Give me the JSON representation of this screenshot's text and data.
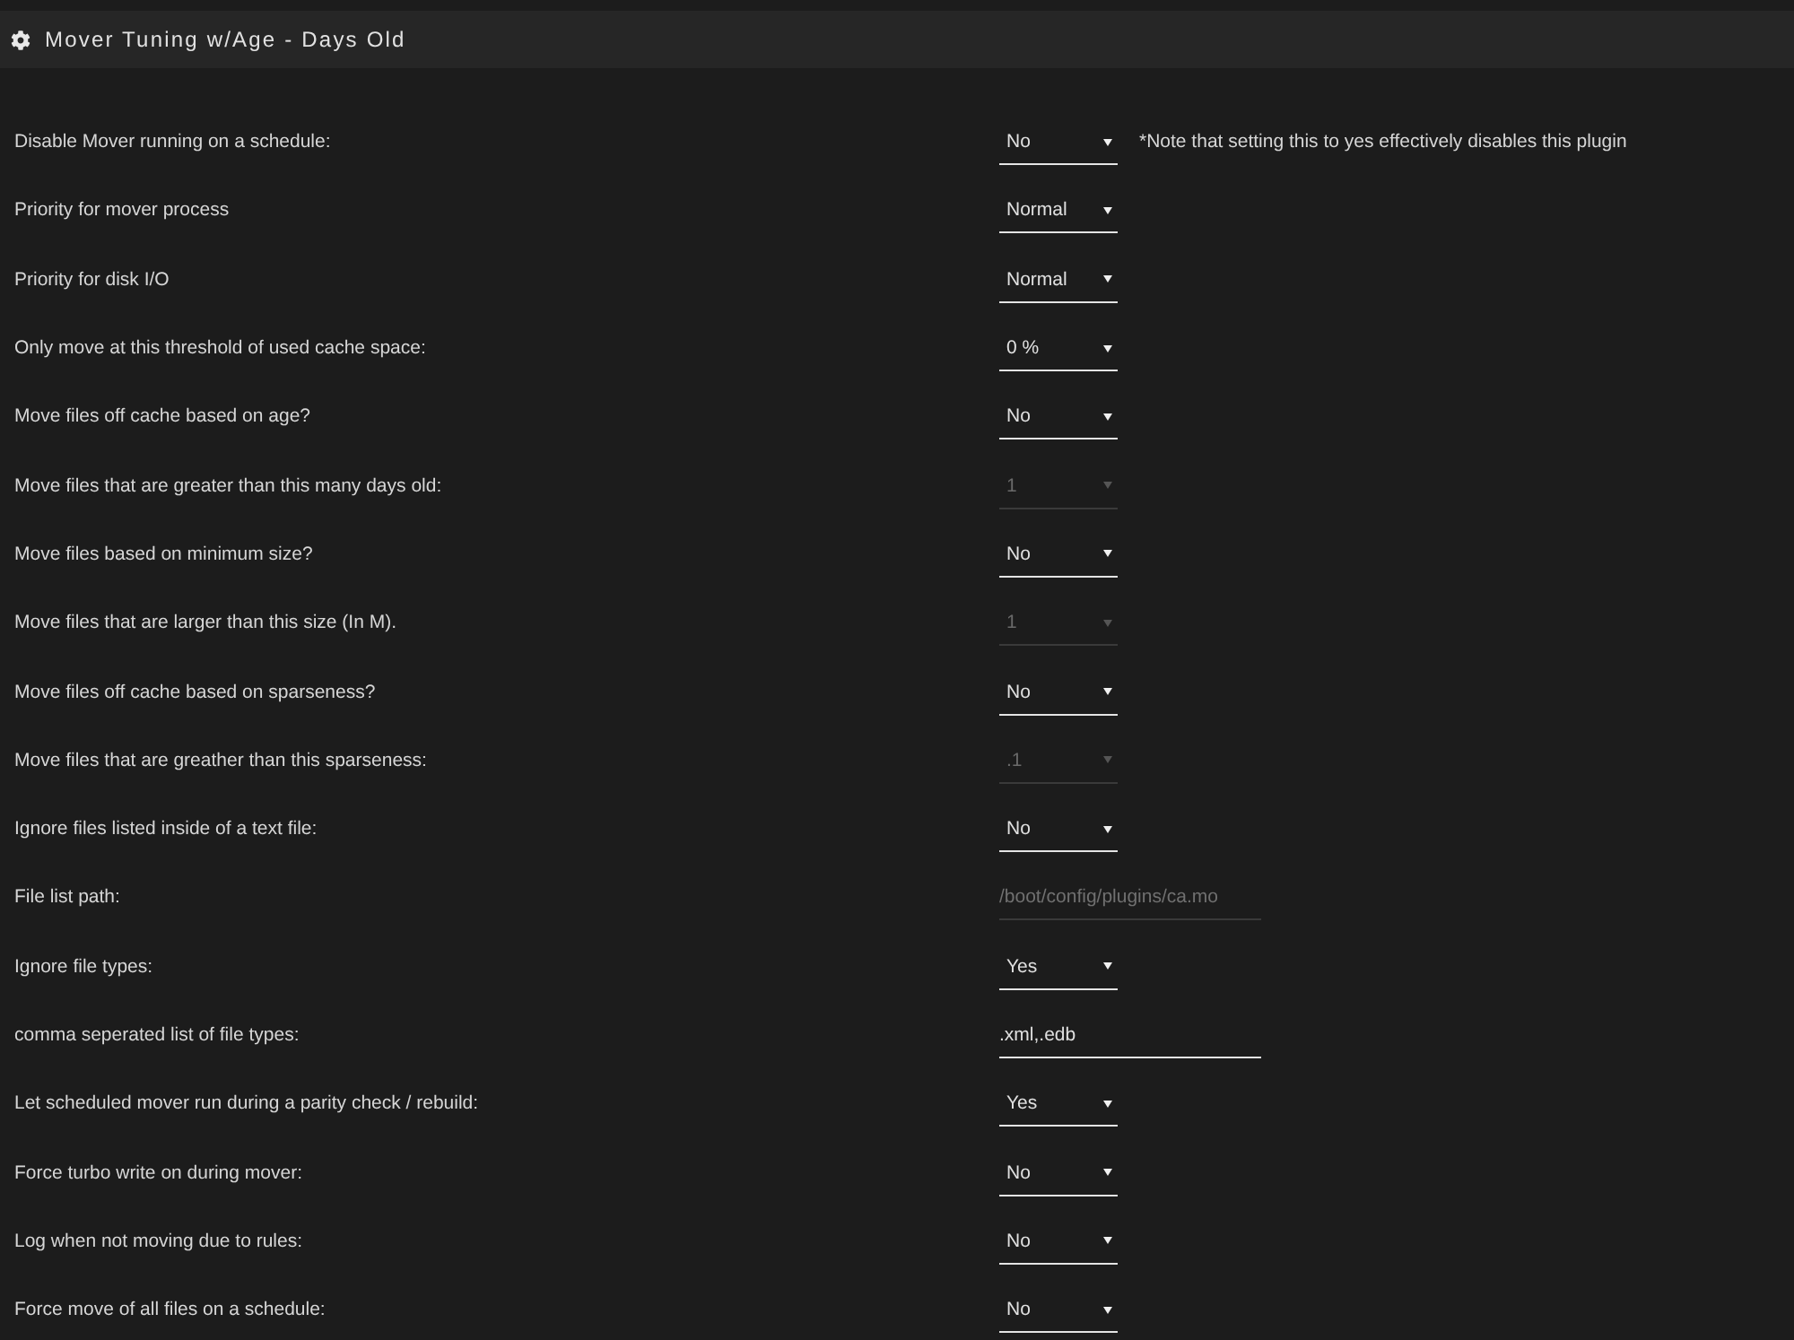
{
  "panel": {
    "title": "Mover Tuning w/Age - Days Old"
  },
  "settings": [
    {
      "label": "Disable Mover running on a schedule:",
      "kind": "select",
      "value": "No",
      "disabled": false,
      "note": "*Note that setting this to yes effectively disables this plugin"
    },
    {
      "label": "Priority for mover process",
      "kind": "select",
      "value": "Normal",
      "disabled": false
    },
    {
      "label": "Priority for disk I/O",
      "kind": "select",
      "value": "Normal",
      "disabled": false
    },
    {
      "label": "Only move at this threshold of used cache space:",
      "kind": "select",
      "value": "0 %",
      "disabled": false
    },
    {
      "label": "Move files off cache based on age?",
      "kind": "select",
      "value": "No",
      "disabled": false
    },
    {
      "label": "Move files that are greater than this many days old:",
      "kind": "select",
      "value": "1",
      "disabled": true
    },
    {
      "label": "Move files based on minimum size?",
      "kind": "select",
      "value": "No",
      "disabled": false
    },
    {
      "label": "Move files that are larger than this size (In M).",
      "kind": "select",
      "value": "1",
      "disabled": true
    },
    {
      "label": "Move files off cache based on sparseness?",
      "kind": "select",
      "value": "No",
      "disabled": false
    },
    {
      "label": "Move files that are greather than this sparseness:",
      "kind": "select",
      "value": ".1",
      "disabled": true
    },
    {
      "label": "Ignore files listed inside of a text file:",
      "kind": "select",
      "value": "No",
      "disabled": false
    },
    {
      "label": "File list path:",
      "kind": "text",
      "value": "/boot/config/plugins/ca.mo",
      "disabled": true
    },
    {
      "label": "Ignore file types:",
      "kind": "select",
      "value": "Yes",
      "disabled": false
    },
    {
      "label": "comma seperated list of file types:",
      "kind": "text",
      "value": ".xml,.edb",
      "disabled": false
    },
    {
      "label": "Let scheduled mover run during a parity check / rebuild:",
      "kind": "select",
      "value": "Yes",
      "disabled": false
    },
    {
      "label": "Force turbo write on during mover:",
      "kind": "select",
      "value": "No",
      "disabled": false
    },
    {
      "label": "Log when not moving due to rules:",
      "kind": "select",
      "value": "No",
      "disabled": false
    },
    {
      "label": "Force move of all files on a schedule:",
      "kind": "select",
      "value": "No",
      "disabled": false
    }
  ]
}
